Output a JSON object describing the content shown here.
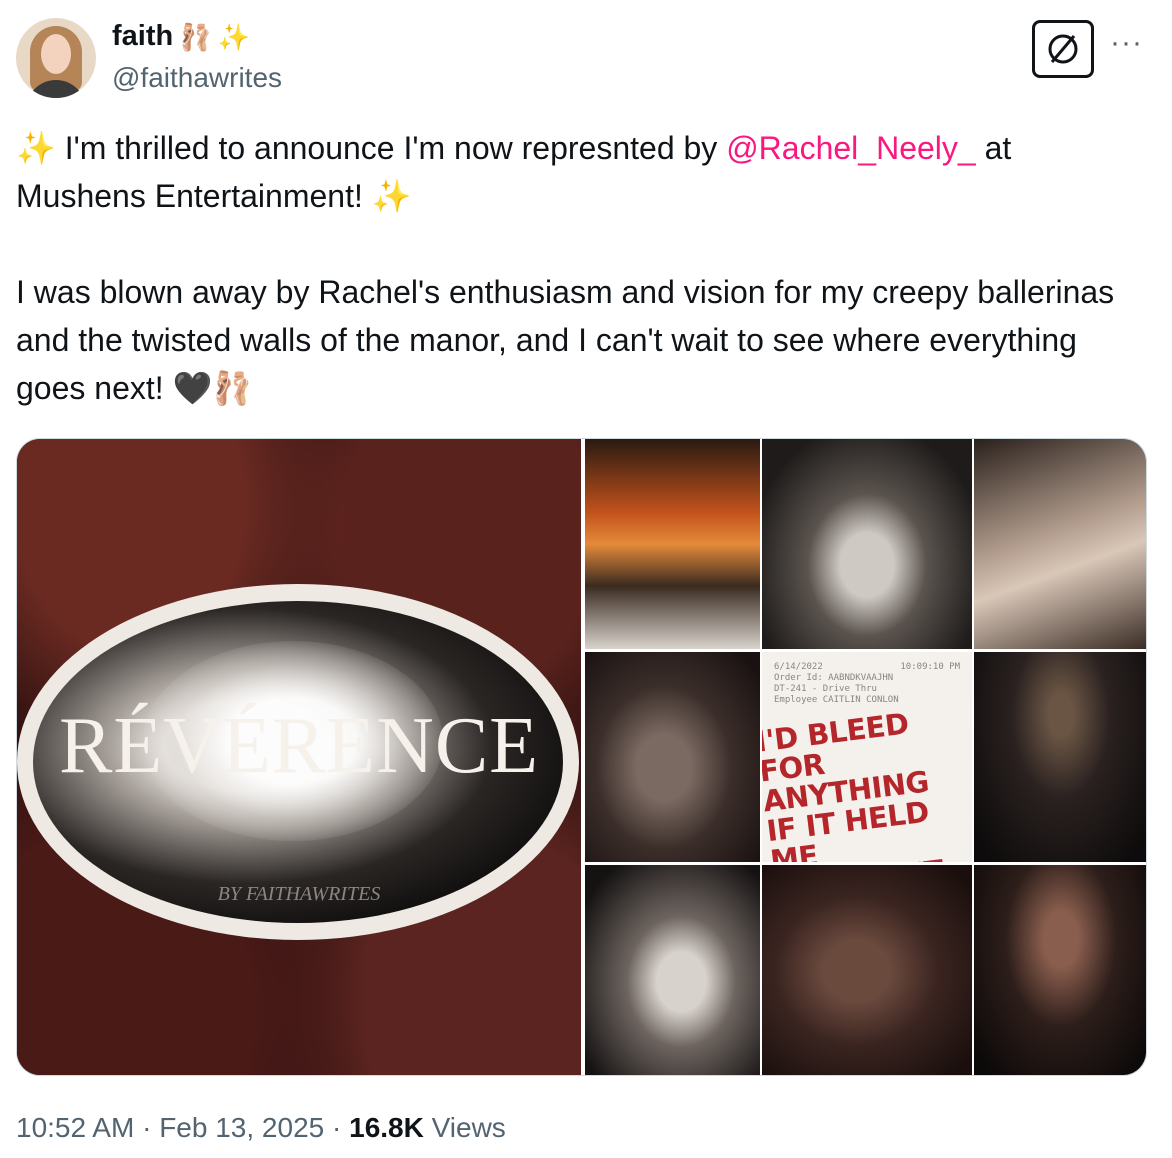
{
  "author": {
    "display_name": "faith",
    "name_emojis": [
      "🩰",
      "✨"
    ],
    "handle": "@faithawrites"
  },
  "icons": {
    "badge": "slashed-circle-icon",
    "more": "more-options-icon"
  },
  "colors": {
    "mention": "#f91880",
    "secondary_text": "#536471",
    "primary_text": "#0f1419"
  },
  "tweet": {
    "line1_emoji_start": "✨",
    "line1_text_before": " I'm thrilled to announce I'm now represnted by ",
    "mention": "@Rachel_Neely_",
    "line1_text_after": " at Mushens Entertainment! ",
    "line1_emoji_end": "✨",
    "para2_text": "I was blown away by Rachel's enthusiasm and vision for my creepy ballerinas and the twisted walls of the manor, and I can't wait to see where everything goes next! ",
    "para2_emojis": [
      "🖤",
      "🩰"
    ]
  },
  "media": {
    "cover_title": "RÉVÉRENCE",
    "cover_byline": "BY FAITHAWRITES",
    "receipt": {
      "date": "6/14/2022",
      "time": "10:09:10 PM",
      "order": "Order Id: AABNDKVAAJHN",
      "line3": "DT-241 - Drive Thru",
      "line4": "Employee CAITLIN CONLON"
    },
    "handwriting_lines": [
      "I'D BLEED",
      "FOR ANYTHING",
      "IF IT HELD ME",
      "THE RIGHT WAY"
    ]
  },
  "meta": {
    "time": "10:52 AM",
    "sep1": " · ",
    "date": "Feb 13, 2025",
    "sep2": " · ",
    "views_count": "16.8K",
    "views_label": " Views"
  }
}
